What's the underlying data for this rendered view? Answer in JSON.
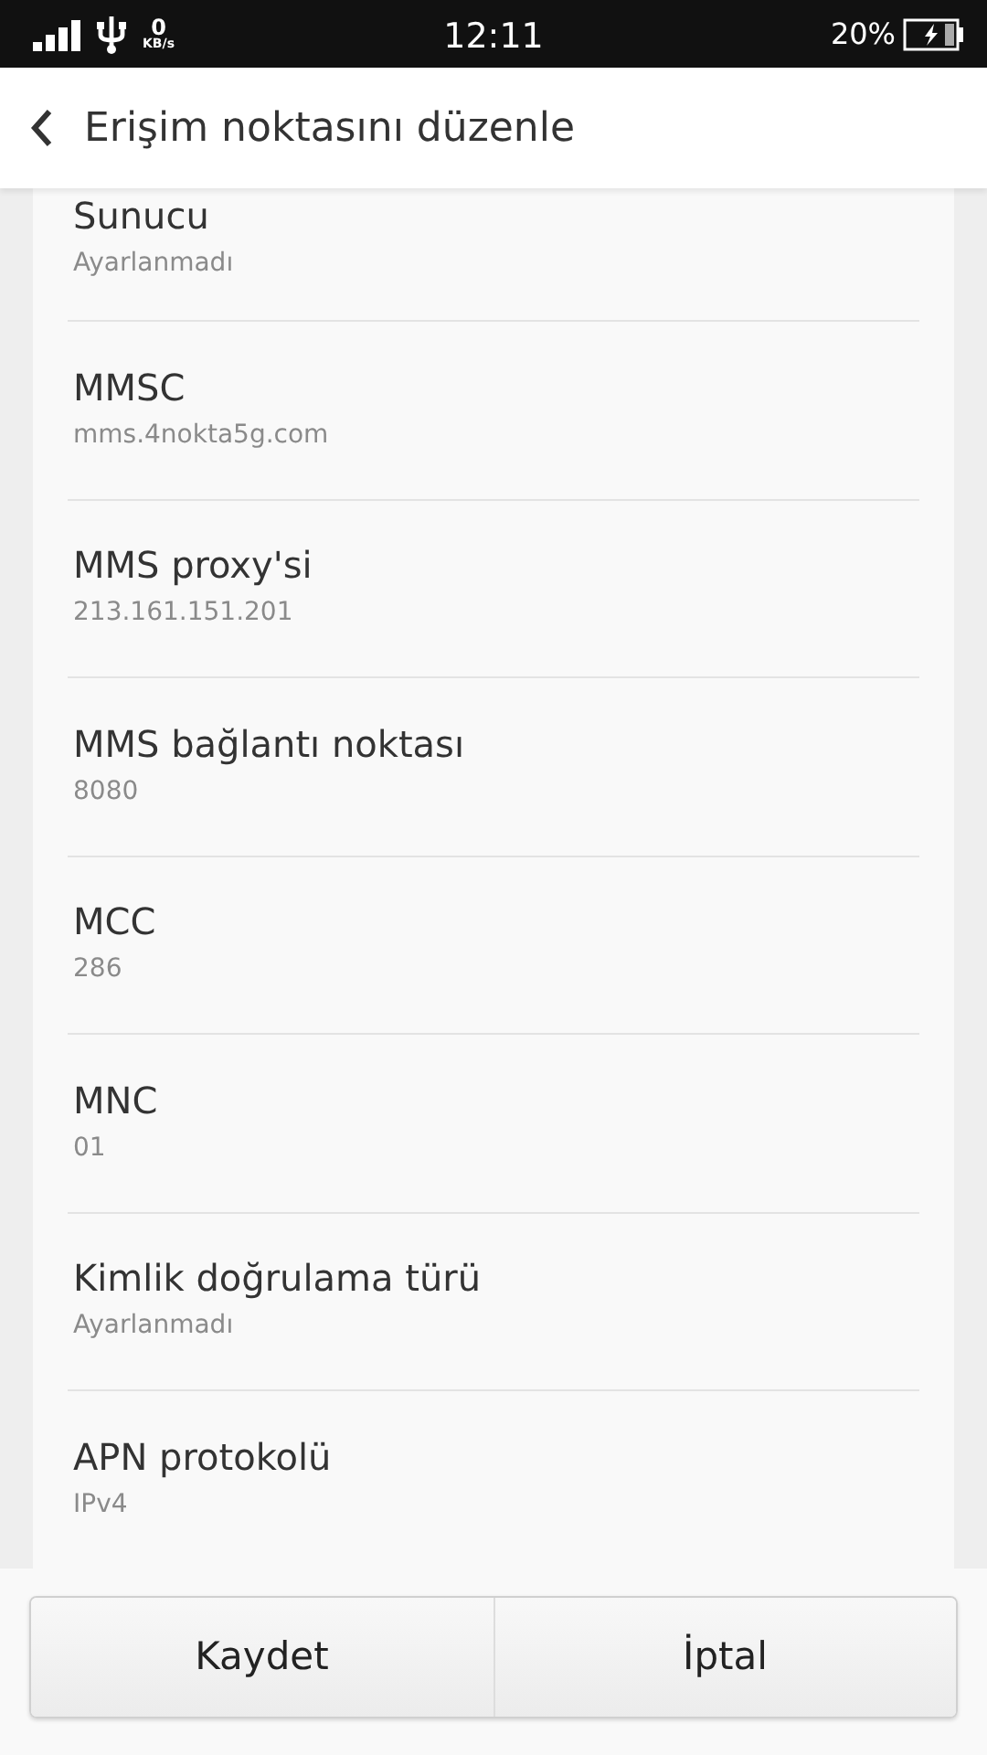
{
  "status_bar": {
    "speed": "0",
    "speed_unit": "KB/s",
    "time": "12:11",
    "battery": "20%"
  },
  "header": {
    "title": "Erişim noktasını düzenle"
  },
  "items": [
    {
      "title": "Sunucu",
      "value": "Ayarlanmadı"
    },
    {
      "title": "MMSC",
      "value": "mms.4nokta5g.com"
    },
    {
      "title": "MMS proxy'si",
      "value": "213.161.151.201"
    },
    {
      "title": "MMS bağlantı noktası",
      "value": "8080"
    },
    {
      "title": "MCC",
      "value": "286"
    },
    {
      "title": "MNC",
      "value": "01"
    },
    {
      "title": "Kimlik doğrulama türü",
      "value": "Ayarlanmadı"
    },
    {
      "title": "APN protokolü",
      "value": "IPv4"
    }
  ],
  "buttons": [
    "Kaydet",
    "İptal"
  ]
}
